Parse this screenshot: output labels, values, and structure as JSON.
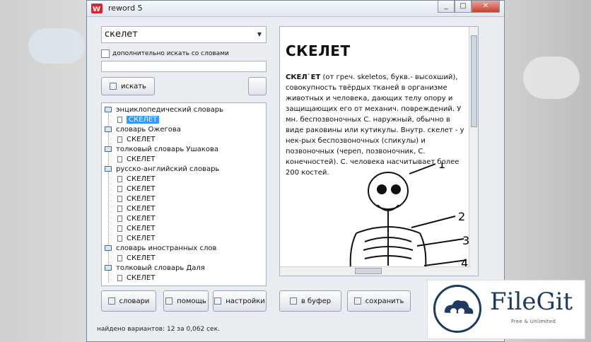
{
  "window": {
    "title": "reword 5",
    "buttons": [
      "minimize",
      "maximize",
      "close"
    ]
  },
  "search": {
    "value": "скелет",
    "checkbox_label": "дополнительно искать со словами",
    "second_input_value": ""
  },
  "buttons": {
    "search": "искать",
    "dictionaries": "словари",
    "help": "помощь",
    "settings": "настройки",
    "copy": "в буфер",
    "save": "сохранить"
  },
  "tree": {
    "groups": [
      {
        "title": "энциклопедический словарь",
        "items": [
          "СКЕЛЕТ"
        ],
        "selected": 0
      },
      {
        "title": "словарь Ожегова",
        "items": [
          "СКЕЛЕТ"
        ]
      },
      {
        "title": "толковый словарь Ушакова",
        "items": [
          "СКЕЛЕТ"
        ]
      },
      {
        "title": "русско-английский словарь",
        "items": [
          "СКЕЛЕТ",
          "СКЕЛЕТ",
          "СКЕЛЕТ",
          "СКЕЛЕТ",
          "СКЕЛЕТ",
          "СКЕЛЕТ",
          "СКЕЛЕТ"
        ]
      },
      {
        "title": "словарь иностранных слов",
        "items": [
          "СКЕЛЕТ"
        ]
      },
      {
        "title": "толковый словарь Даля",
        "items": [
          "СКЕЛЕТ"
        ]
      }
    ]
  },
  "article": {
    "heading": "СКЕЛЕТ",
    "term": "СКЕЛ`ЕТ",
    "body": " (от греч. skeletos, букв.- высохший), совокупность твёрдых тканей в организме животных и человека, дающих телу опору и защищающих его от механич. повреждений. У мн. беспозвоночных С. наружный, обычно в виде раковины или кутикулы. Внутр. скелет - у нек-рых беспозвоночных (спикулы) и позвоночных (череп, позвоночник, С. конечностей). С. человека насчитывает более 200 костей.",
    "figure_labels": [
      "1",
      "2",
      "3",
      "4"
    ]
  },
  "status": "найдено вариантов: 12 за 0,062 сек.",
  "watermark": {
    "title": "FileGit",
    "subtitle": "Free & Unlimited"
  }
}
